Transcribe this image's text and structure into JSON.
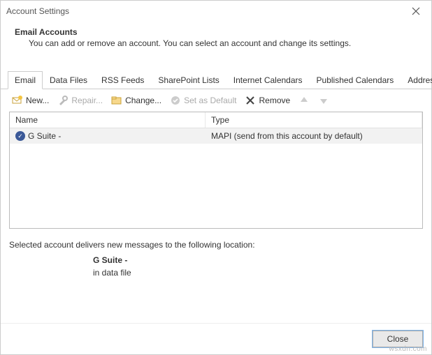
{
  "window": {
    "title": "Account Settings"
  },
  "header": {
    "heading": "Email Accounts",
    "subheading": "You can add or remove an account. You can select an account and change its settings."
  },
  "tabs": [
    {
      "label": "Email",
      "active": true
    },
    {
      "label": "Data Files"
    },
    {
      "label": "RSS Feeds"
    },
    {
      "label": "SharePoint Lists"
    },
    {
      "label": "Internet Calendars"
    },
    {
      "label": "Published Calendars"
    },
    {
      "label": "Address Books"
    }
  ],
  "toolbar": {
    "new": "New...",
    "repair": "Repair...",
    "change": "Change...",
    "set_default": "Set as Default",
    "remove": "Remove"
  },
  "list": {
    "columns": {
      "name": "Name",
      "type": "Type"
    },
    "rows": [
      {
        "name": "G Suite -",
        "type": "MAPI (send from this account by default)"
      }
    ]
  },
  "delivery": {
    "intro": "Selected account delivers new messages to the following location:",
    "account": "G Suite -",
    "location": "in data file"
  },
  "footer": {
    "close": "Close"
  },
  "watermark": "wsxdn.com"
}
